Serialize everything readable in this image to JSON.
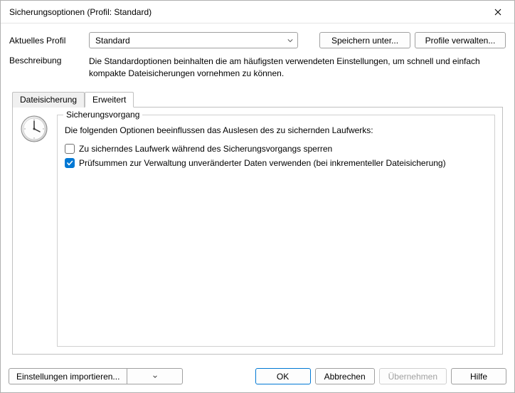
{
  "window": {
    "title": "Sicherungsoptionen (Profil: Standard)"
  },
  "header": {
    "profile_label": "Aktuelles Profil",
    "profile_value": "Standard",
    "save_as_btn": "Speichern unter...",
    "manage_profiles_btn": "Profile verwalten...",
    "description_label": "Beschreibung",
    "description_text": "Die Standardoptionen beinhalten die am häufigsten verwendeten Einstellungen, um schnell und einfach kompakte Dateisicherungen vornehmen zu können."
  },
  "tabs": {
    "backup": "Dateisicherung",
    "advanced": "Erweitert"
  },
  "advanced_panel": {
    "group_title": "Sicherungsvorgang",
    "group_desc": "Die folgenden Optionen beeinflussen das Auslesen des zu sichernden Laufwerks:",
    "opt_lock": {
      "label": "Zu sicherndes Laufwerk während des Sicherungsvorgangs sperren",
      "checked": false
    },
    "opt_checksums": {
      "label": "Prüfsummen zur Verwaltung unveränderter Daten verwenden (bei inkrementeller Dateisicherung)",
      "checked": true
    }
  },
  "footer": {
    "import": "Einstellungen importieren...",
    "ok": "OK",
    "cancel": "Abbrechen",
    "apply": "Übernehmen",
    "help": "Hilfe"
  }
}
